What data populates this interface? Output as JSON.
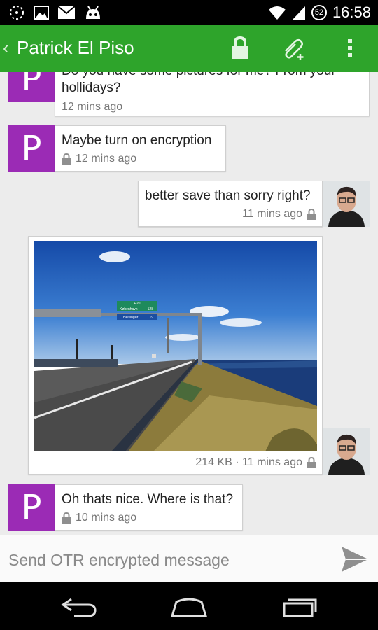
{
  "status_bar": {
    "time": "16:58",
    "battery_level": "52",
    "left_icons": [
      "dashed-circle-icon",
      "image-icon",
      "gmail-icon",
      "android-icon"
    ],
    "right_icons": [
      "wifi-icon",
      "signal-icon",
      "battery-icon"
    ]
  },
  "action_bar": {
    "contact_name": "Patrick El Piso",
    "icons": [
      "lock-icon",
      "attach-icon",
      "overflow-menu-icon"
    ],
    "accent_color": "#2ea42b"
  },
  "messages": [
    {
      "from": "contact",
      "avatar_letter": "P",
      "text": "Do you have some pictures for me? From your hollidays?",
      "time": "12 mins ago",
      "encrypted": false
    },
    {
      "from": "contact",
      "avatar_letter": "P",
      "text": "Maybe turn on encryption",
      "time": "12 mins ago",
      "encrypted": true
    },
    {
      "from": "me",
      "text": "better save than sorry right?",
      "time": "11 mins ago",
      "encrypted": true
    },
    {
      "from": "me",
      "type": "image",
      "size": "214 KB",
      "time": "11 mins ago",
      "meta": "214 KB · 11 mins ago",
      "encrypted": true
    },
    {
      "from": "contact",
      "avatar_letter": "P",
      "text": "Oh thats nice. Where is that?",
      "time": "10 mins ago",
      "encrypted": true
    }
  ],
  "photo": {
    "sign_top": "E20",
    "sign_line1": "København",
    "sign_line1_km": "128",
    "sign_line2": "Helsingør",
    "sign_line2_km": "19"
  },
  "compose": {
    "placeholder": "Send OTR encrypted message"
  },
  "nav_bar": {
    "icons": [
      "back-icon",
      "home-icon",
      "recent-apps-icon"
    ]
  },
  "colors": {
    "contact_avatar": "#9b2bb5",
    "background": "#ececec"
  }
}
